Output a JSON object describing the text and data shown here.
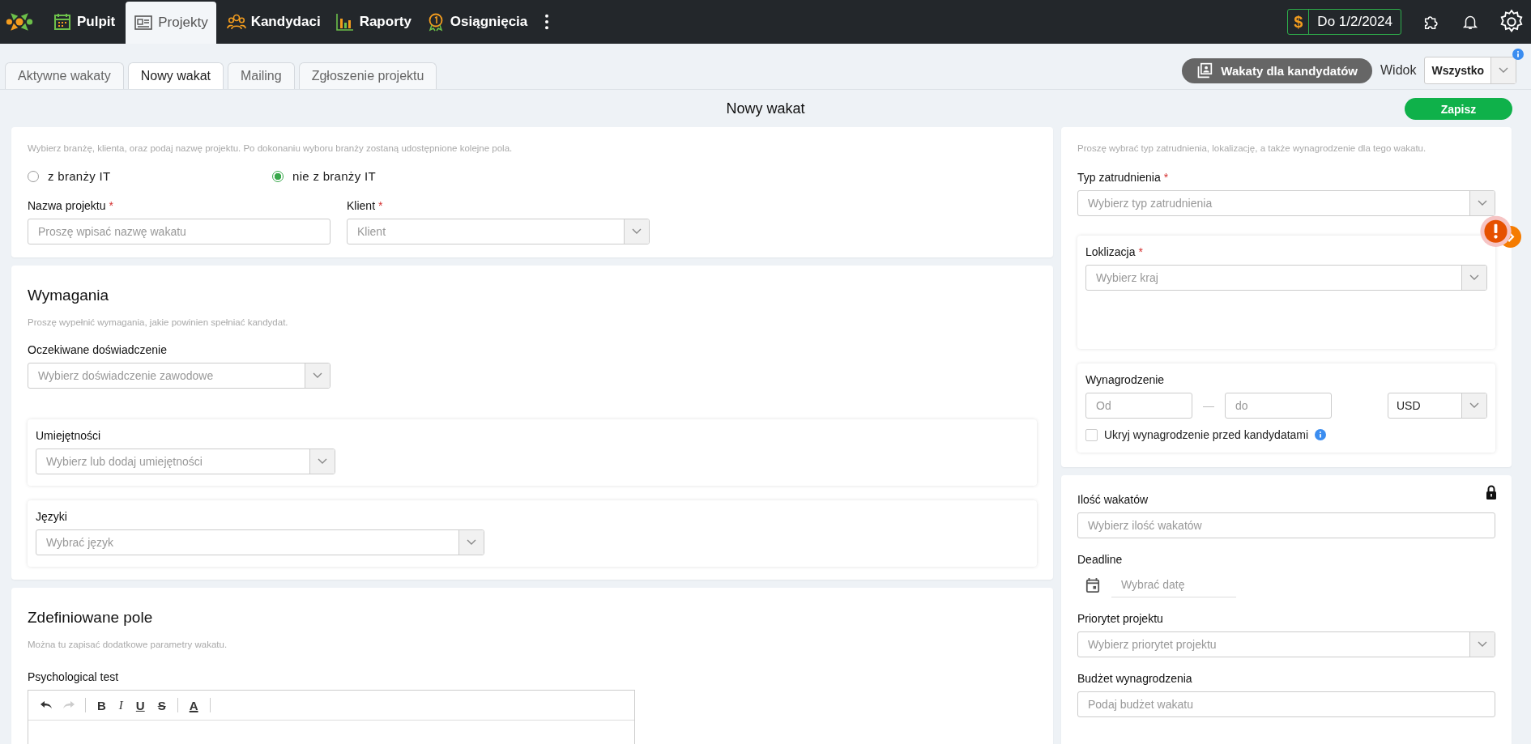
{
  "nav": {
    "items": [
      {
        "label": "Pulpit",
        "kind": "calendar",
        "selected": false
      },
      {
        "label": "Projekty",
        "kind": "card",
        "selected": true
      },
      {
        "label": "Kandydaci",
        "kind": "people",
        "selected": false
      },
      {
        "label": "Raporty",
        "kind": "chart",
        "selected": false
      },
      {
        "label": "Osiągnięcia",
        "kind": "medal",
        "selected": false
      }
    ]
  },
  "plan": {
    "symbol": "$",
    "label": "Do 1/2/2024"
  },
  "subtabs": [
    {
      "label": "Aktywne wakaty",
      "selected": false
    },
    {
      "label": "Nowy wakat",
      "selected": true
    },
    {
      "label": "Mailing",
      "selected": false
    },
    {
      "label": "Zgłoszenie projektu",
      "selected": false
    }
  ],
  "candidate_button": "Wakaty dla kandydatów",
  "view": {
    "label": "Widok",
    "value": "Wszystko"
  },
  "page_title": "Nowy wakat",
  "save_button": "Zapisz",
  "project_card": {
    "hint": "Wybierz branżę, klienta, oraz podaj nazwę projektu. Po dokonaniu wyboru branży zostaną udostępnione kolejne pola.",
    "industry": [
      {
        "label": "z branży IT",
        "selected": false
      },
      {
        "label": "nie z branży IT",
        "selected": true
      }
    ],
    "fields": [
      {
        "label": "Nazwa projektu",
        "mark": "*",
        "kind": "input",
        "placeholder": "Proszę wpisać nazwę wakatu"
      },
      {
        "label": "Klient",
        "mark": "*",
        "kind": "select",
        "placeholder": "Klient"
      }
    ]
  },
  "requirements": {
    "title": "Wymagania",
    "hint": "Proszę wypełnić wymagania, jakie powinien spełniać kandydat.",
    "experience": {
      "label": "Oczekiwane doświadczenie",
      "placeholder": "Wybierz doświadczenie zawodowe"
    },
    "skills": {
      "label": "Umiejętności",
      "placeholder": "Wybierz lub dodaj umiejętności"
    },
    "languages": {
      "label": "Języki",
      "placeholder": "Wybrać język"
    }
  },
  "custom_fields": {
    "title": "Zdefiniowane pole",
    "hint": "Można tu zapisać dodatkowe parametry wakatu.",
    "field_label": "Psychological test",
    "history": [
      {
        "kind": "undo",
        "disabled": false
      },
      {
        "kind": "redo",
        "disabled": true
      }
    ],
    "format": [
      {
        "kind": "bold",
        "label": "B"
      },
      {
        "kind": "italic",
        "label": "I"
      },
      {
        "kind": "underline",
        "label": "U"
      },
      {
        "kind": "strike",
        "label": "S"
      },
      {
        "kind": "color",
        "label": "A"
      }
    ]
  },
  "employment_card": {
    "hint": "Proszę wybrać typ zatrudnienia, lokalizację, a także wynagrodzenie dla tego wakatu.",
    "employment": {
      "label": "Typ zatrudnienia",
      "mark": "*",
      "placeholder": "Wybierz typ zatrudnienia"
    },
    "location": {
      "label": "Loklizacja",
      "mark": "*",
      "placeholder": "Wybierz kraj"
    },
    "salary": {
      "label": "Wynagrodzenie",
      "from_placeholder": "Od",
      "separator": "—",
      "to_placeholder": "do",
      "currency": "USD",
      "hide_label": "Ukryj wynagrodzenie przed kandydatami",
      "hide_checked": false
    }
  },
  "details_card": {
    "vacancies": {
      "label": "Ilość wakatów",
      "placeholder": "Wybierz ilość wakatów"
    },
    "deadline": {
      "label": "Deadline",
      "placeholder": "Wybrać datę"
    },
    "priority": {
      "label": "Priorytet projektu",
      "placeholder": "Wybierz priorytet projektu"
    },
    "budget": {
      "label": "Budżet wynagrodzenia",
      "placeholder": "Podaj budżet wakatu"
    }
  }
}
